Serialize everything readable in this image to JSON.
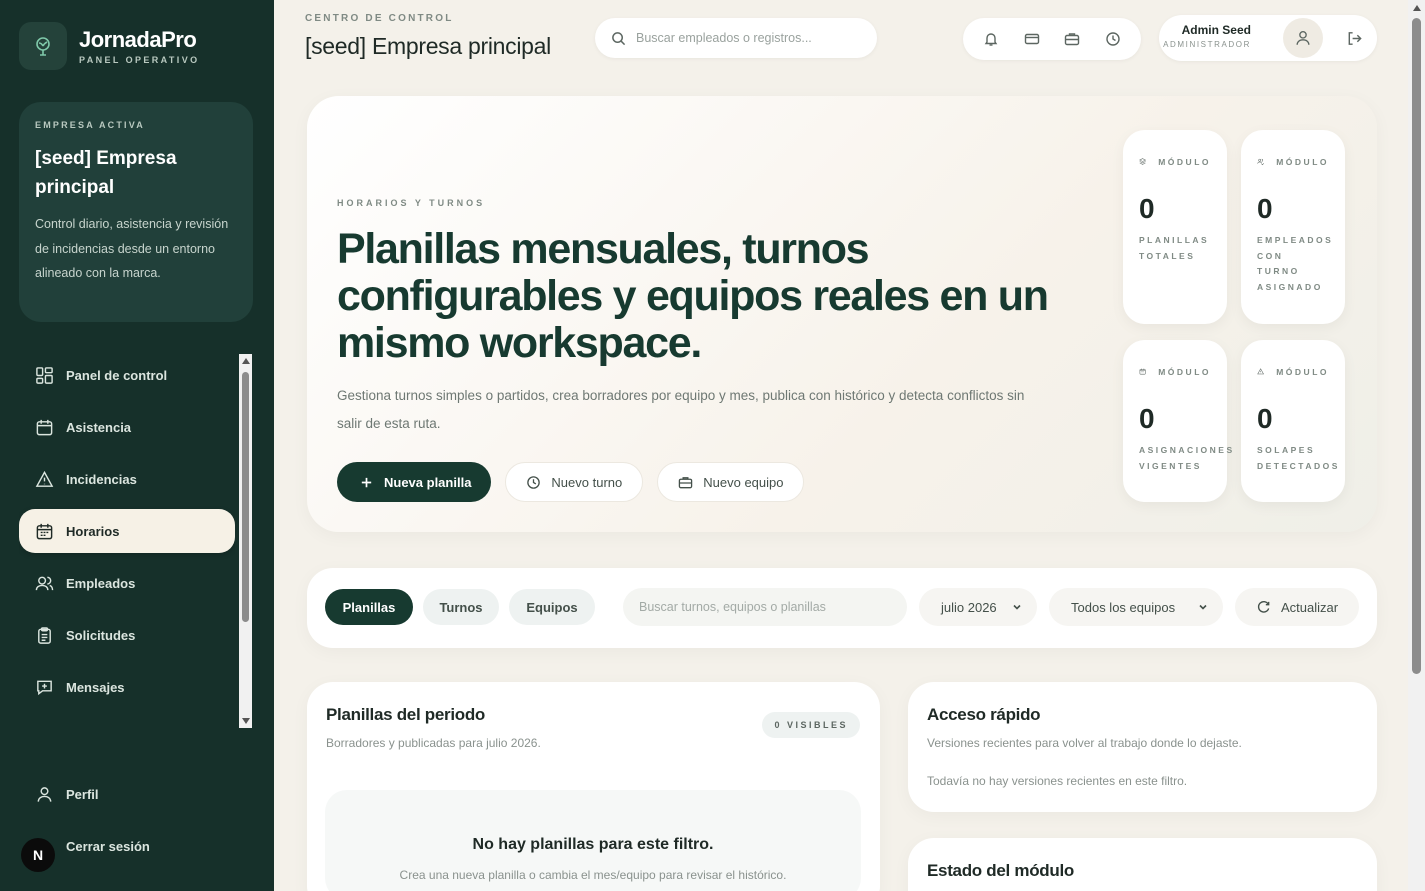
{
  "brand": {
    "name": "JornadaPro",
    "subtitle": "PANEL OPERATIVO"
  },
  "company": {
    "kicker": "EMPRESA ACTIVA",
    "name": "[seed] Empresa principal",
    "description": "Control diario, asistencia y revisión de incidencias desde un entorno alineado con la marca."
  },
  "nav": {
    "items": [
      {
        "label": "Panel de control",
        "icon": "dashboard-icon"
      },
      {
        "label": "Asistencia",
        "icon": "calendar-icon"
      },
      {
        "label": "Incidencias",
        "icon": "warning-icon"
      },
      {
        "label": "Horarios",
        "icon": "calendar-grid-icon",
        "active": true
      },
      {
        "label": "Empleados",
        "icon": "users-icon"
      },
      {
        "label": "Solicitudes",
        "icon": "clipboard-icon"
      },
      {
        "label": "Mensajes",
        "icon": "message-icon"
      }
    ],
    "bottom": [
      {
        "label": "Perfil",
        "icon": "user-icon"
      },
      {
        "label": "Cerrar sesión",
        "icon": "logout-icon"
      }
    ],
    "next_badge": "N"
  },
  "topbar": {
    "kicker": "CENTRO DE CONTROL",
    "title": "[seed] Empresa principal",
    "search_placeholder": "Buscar empleados o registros...",
    "icons": [
      "bell-icon",
      "card-icon",
      "briefcase-icon",
      "clock-icon"
    ],
    "user_name": "Admin Seed",
    "user_role": "ADMINISTRADOR"
  },
  "hero": {
    "kicker": "HORARIOS Y TURNOS",
    "title": "Planillas mensuales, turnos configurables y equipos reales en un mismo workspace.",
    "description": "Gestiona turnos simples o partidos, crea borradores por equipo y mes, publica con histórico y detecta conflictos sin salir de esta ruta.",
    "actions": {
      "primary": "Nueva planilla",
      "turn": "Nuevo turno",
      "team": "Nuevo equipo"
    },
    "stats": [
      {
        "kicker": "MÓDULO",
        "value": "0",
        "label": "PLANILLAS\nTOTALES",
        "icon": "layers-icon"
      },
      {
        "kicker": "MÓDULO",
        "value": "0",
        "label": "EMPLEADOS\nCON\nTURNO\nASIGNADO",
        "icon": "users-check-icon"
      },
      {
        "kicker": "MÓDULO",
        "value": "0",
        "label": "ASIGNACIONES\nVIGENTES",
        "icon": "calendar-icon"
      },
      {
        "kicker": "MÓDULO",
        "value": "0",
        "label": "SOLAPES\nDETECTADOS",
        "icon": "warning-icon"
      }
    ]
  },
  "filters": {
    "tabs": [
      "Planillas",
      "Turnos",
      "Equipos"
    ],
    "search_placeholder": "Buscar turnos, equipos o planillas",
    "month": "julio 2026",
    "team": "Todos los equipos",
    "refresh": "Actualizar"
  },
  "planillas_panel": {
    "title": "Planillas del periodo",
    "subtitle": "Borradores y publicadas para julio 2026.",
    "badge": "0 VISIBLES",
    "empty_title": "No hay planillas para este filtro.",
    "empty_subtitle": "Crea una nueva planilla o cambia el mes/equipo para revisar el histórico."
  },
  "quick_panel": {
    "title": "Acceso rápido",
    "subtitle": "Versiones recientes para volver al trabajo donde lo dejaste.",
    "note": "Todavía no hay versiones recientes en este filtro."
  },
  "status_panel": {
    "title": "Estado del módulo"
  }
}
